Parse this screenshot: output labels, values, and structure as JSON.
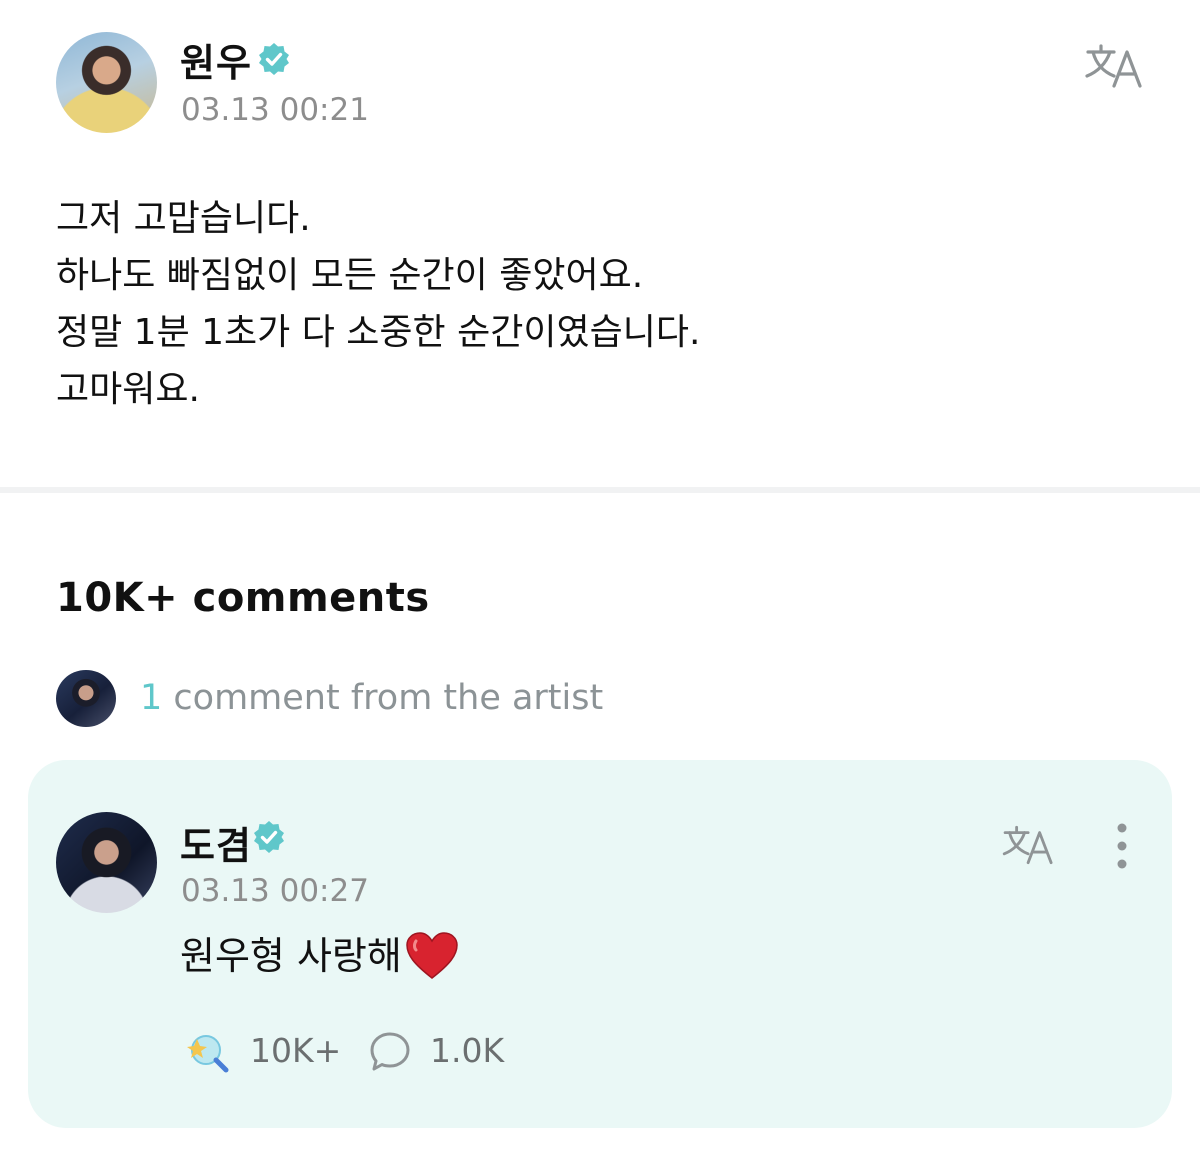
{
  "post": {
    "author": "원우",
    "time": "03.13 00:21",
    "lines": [
      "그저 고맙습니다.",
      "하나도 빠짐없이 모든 순간이 좋았어요.",
      "정말 1분 1초가 다 소중한 순간이였습니다.",
      "고마워요."
    ]
  },
  "comments": {
    "count_label": "10K+ comments",
    "artist_row": {
      "count": "1",
      "label": "comment from the artist"
    },
    "artist_comment": {
      "author": "도겸",
      "time": "03.13 00:27",
      "text": "원우형 사랑해",
      "likes": "10K+",
      "replies": "1.0K"
    }
  },
  "icons": {
    "verified": "verified-badge-icon",
    "translate": "translate-icon",
    "more": "more-vertical-icon",
    "heart": "heart-emoji-icon",
    "like": "sparkle-like-icon",
    "reply": "speech-bubble-icon"
  },
  "colors": {
    "accent": "#5fc7ca",
    "card_background": "#eaf8f6",
    "secondary_text": "#8d8d8d",
    "heart": "#d8232f"
  }
}
